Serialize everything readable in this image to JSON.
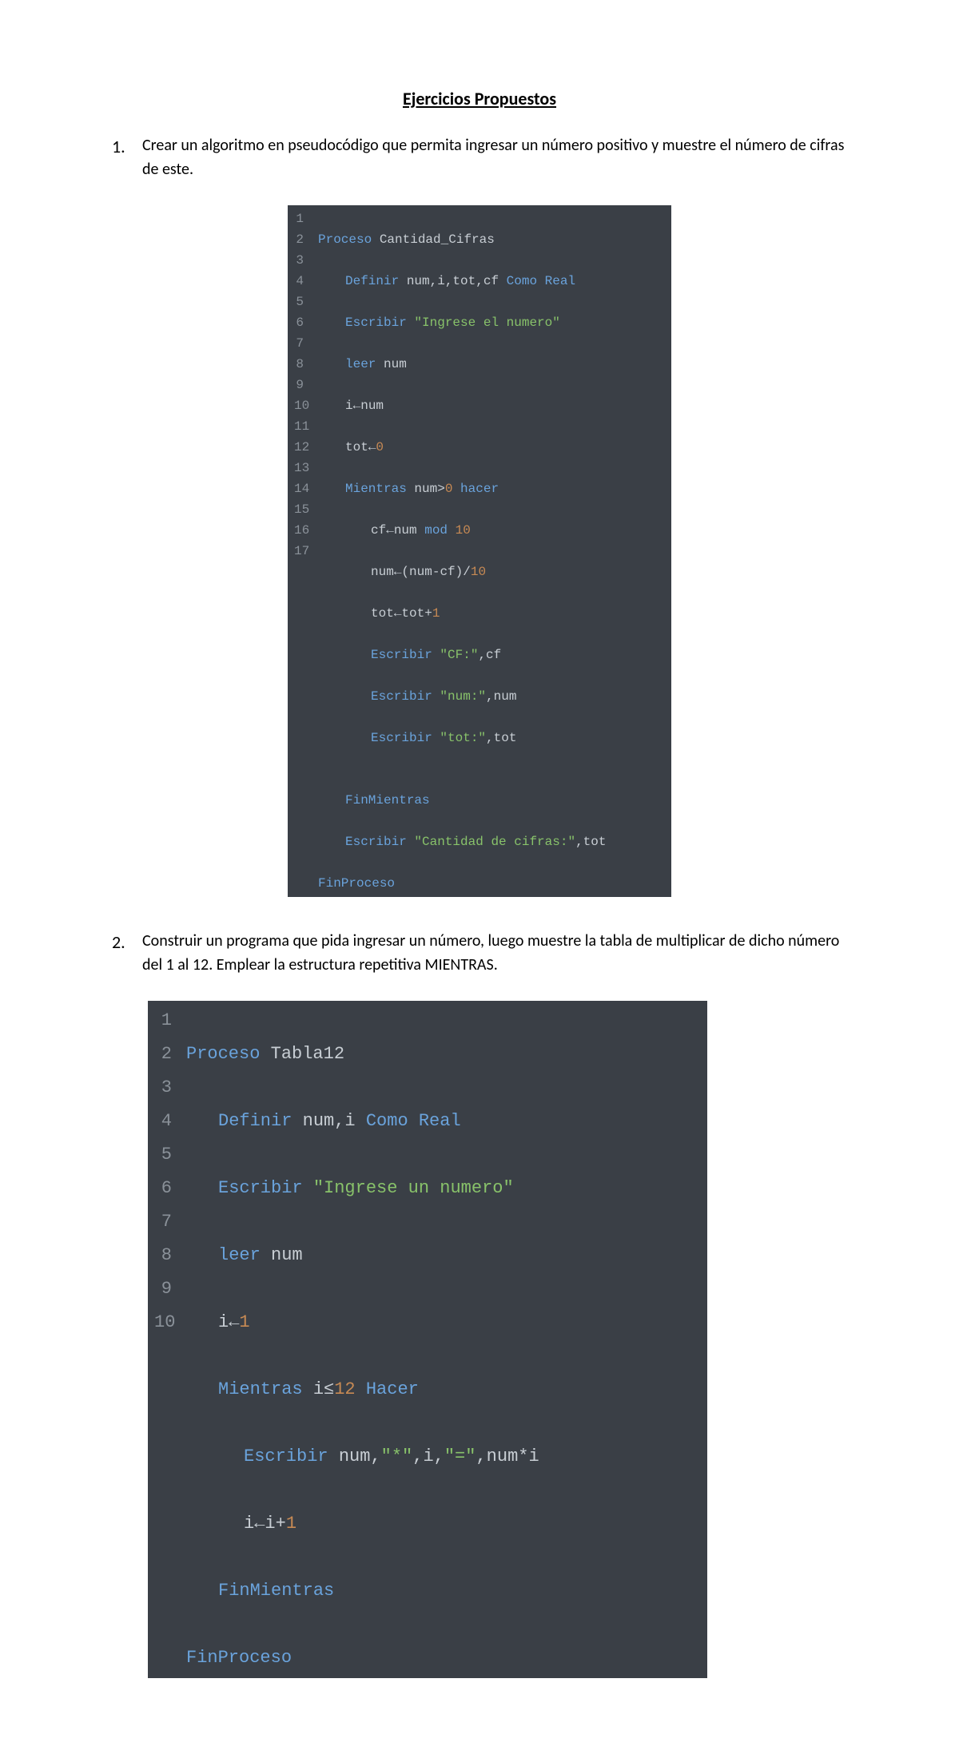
{
  "title": "Ejercicios Propuestos",
  "exercises": [
    {
      "num": "1.",
      "desc": "Crear un algoritmo en pseudocódigo que permita ingresar un número positivo y muestre el número de cifras de este."
    },
    {
      "num": "2.",
      "desc": "Construir un programa que pida ingresar un número, luego muestre la tabla de multiplicar de dicho número del 1 al 12. Emplear la estructura repetitiva MIENTRAS."
    }
  ],
  "code1": {
    "line_count": 17,
    "tokens": {
      "l1_kw": "Proceso",
      "l1_id": " Cantidad_Cifras",
      "l2_kw": "Definir",
      "l2_id": " num,i,tot,cf ",
      "l2_kw2": "Como Real",
      "l3_kw": "Escribir ",
      "l3_str": "\"Ingrese el numero\"",
      "l4_kw": "leer",
      "l4_id": " num",
      "l5_id": "i",
      "l5_op": "←",
      "l5_id2": "num",
      "l6_id": "tot",
      "l6_op": "←",
      "l6_num": "0",
      "l7_kw": "Mientras ",
      "l7_id": "num",
      "l7_op": ">",
      "l7_num": "0",
      "l7_kw2": " hacer",
      "l8_id": "cf",
      "l8_op": "←",
      "l8_id2": "num ",
      "l8_kw": "mod ",
      "l8_num": "10",
      "l9_id": "num",
      "l9_op": "←(",
      "l9_id2": "num",
      "l9_op2": "-",
      "l9_id3": "cf",
      "l9_op3": ")/",
      "l9_num": "10",
      "l10_id": "tot",
      "l10_op": "←",
      "l10_id2": "tot",
      "l10_op2": "+",
      "l10_num": "1",
      "l11_kw": "Escribir ",
      "l11_str": "\"CF:\"",
      "l11_op": ",",
      "l11_id": "cf",
      "l12_kw": "Escribir ",
      "l12_str": "\"num:\"",
      "l12_op": ",",
      "l12_id": "num",
      "l13_kw": "Escribir ",
      "l13_str": "\"tot:\"",
      "l13_op": ",",
      "l13_id": "tot",
      "l14": "",
      "l15_kw": "FinMientras",
      "l16_kw": "Escribir ",
      "l16_str": "\"Cantidad de cifras:\"",
      "l16_op": ",",
      "l16_id": "tot",
      "l17_kw": "FinProceso"
    }
  },
  "code2": {
    "line_count": 10,
    "tokens": {
      "l1_kw": "Proceso",
      "l1_id": " Tabla12",
      "l2_kw": "Definir",
      "l2_id": " num,i ",
      "l2_kw2": "Como Real",
      "l3_kw": "Escribir ",
      "l3_str": "\"Ingrese un numero\"",
      "l4_kw": "leer",
      "l4_id": " num",
      "l5_id": "i",
      "l5_op": "←",
      "l5_num": "1",
      "l6_kw": "Mientras ",
      "l6_id": "i",
      "l6_op": "≤",
      "l6_num": "12",
      "l6_kw2": " Hacer",
      "l7_kw": "Escribir ",
      "l7_id": "num",
      "l7_op": ",",
      "l7_str": "\"*\"",
      "l7_op2": ",",
      "l7_id2": "i",
      "l7_op3": ",",
      "l7_str2": "\"=\"",
      "l7_op4": ",",
      "l7_id3": "num",
      "l7_op5": "*",
      "l7_id4": "i",
      "l8_id": "i",
      "l8_op": "←",
      "l8_id2": "i",
      "l8_op2": "+",
      "l8_num": "1",
      "l9_kw": "FinMientras",
      "l10_kw": "FinProceso"
    }
  }
}
